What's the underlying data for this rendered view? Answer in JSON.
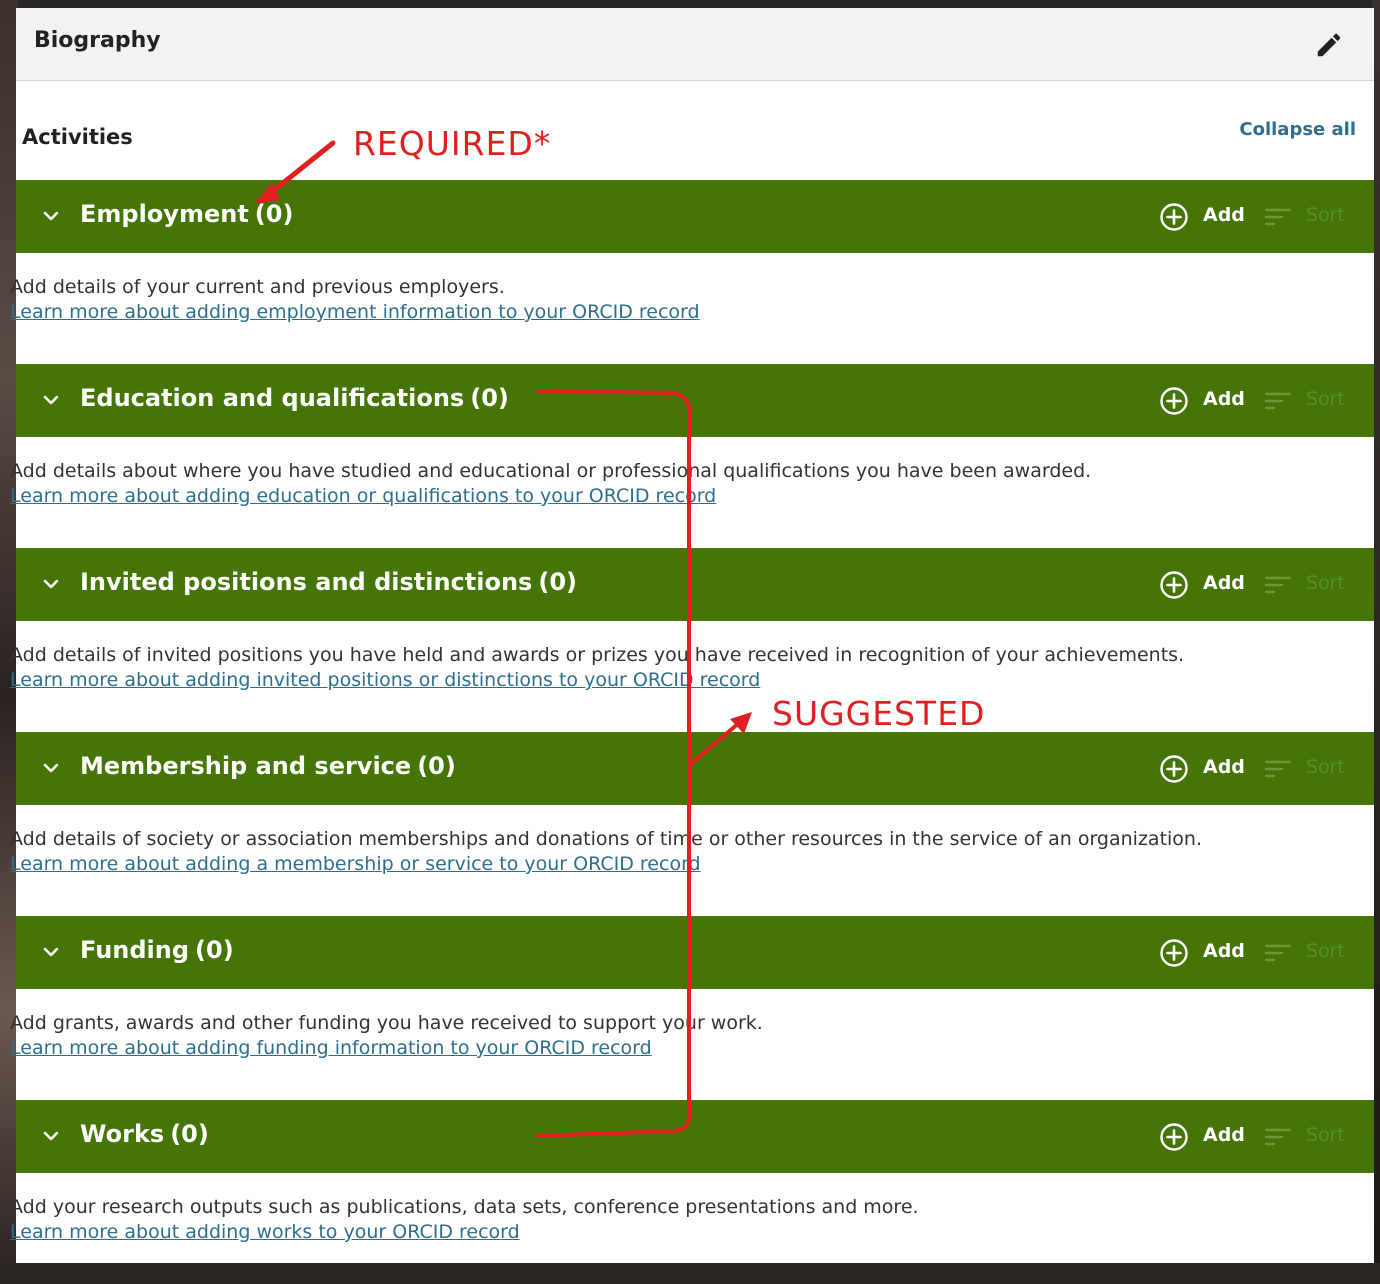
{
  "header": {
    "title": "Biography",
    "edit_icon": "pencil-icon"
  },
  "activities": {
    "title": "Activities",
    "collapse_all": "Collapse all"
  },
  "sections": [
    {
      "title": "Employment",
      "count": "(0)",
      "add": "Add",
      "sort": "Sort",
      "description": "Add details of your current and previous employers.",
      "learn_more": "Learn more about adding employment information to your ORCID record"
    },
    {
      "title": "Education and qualifications",
      "count": "(0)",
      "add": "Add",
      "sort": "Sort",
      "description": "Add details about where you have studied and educational or professional qualifications you have been awarded.",
      "learn_more": "Learn more about adding education or qualifications to your ORCID record"
    },
    {
      "title": "Invited positions and distinctions",
      "count": "(0)",
      "add": "Add",
      "sort": "Sort",
      "description": "Add details of invited positions you have held and awards or prizes you have received in recognition of your achievements.",
      "learn_more": "Learn more about adding invited positions or distinctions to your ORCID record"
    },
    {
      "title": "Membership and service",
      "count": "(0)",
      "add": "Add",
      "sort": "Sort",
      "description": "Add details of society or association memberships and donations of time or other resources in the service of an organization.",
      "learn_more": "Learn more about adding a membership or service to your ORCID record"
    },
    {
      "title": "Funding",
      "count": "(0)",
      "add": "Add",
      "sort": "Sort",
      "description": "Add grants, awards and other funding you have received to support your work.",
      "learn_more": "Learn more about adding funding information to your ORCID record"
    },
    {
      "title": "Works",
      "count": "(0)",
      "add": "Add",
      "sort": "Sort",
      "description": "Add your research outputs such as publications, data sets, conference presentations and more.",
      "learn_more": "Learn more about adding works to your ORCID record"
    }
  ],
  "annotations": {
    "required": "REQUIRED*",
    "suggested": "SUGGESTED",
    "color": "#e02020"
  },
  "colors": {
    "section_bg": "#457506",
    "link": "#2e6e8e"
  }
}
